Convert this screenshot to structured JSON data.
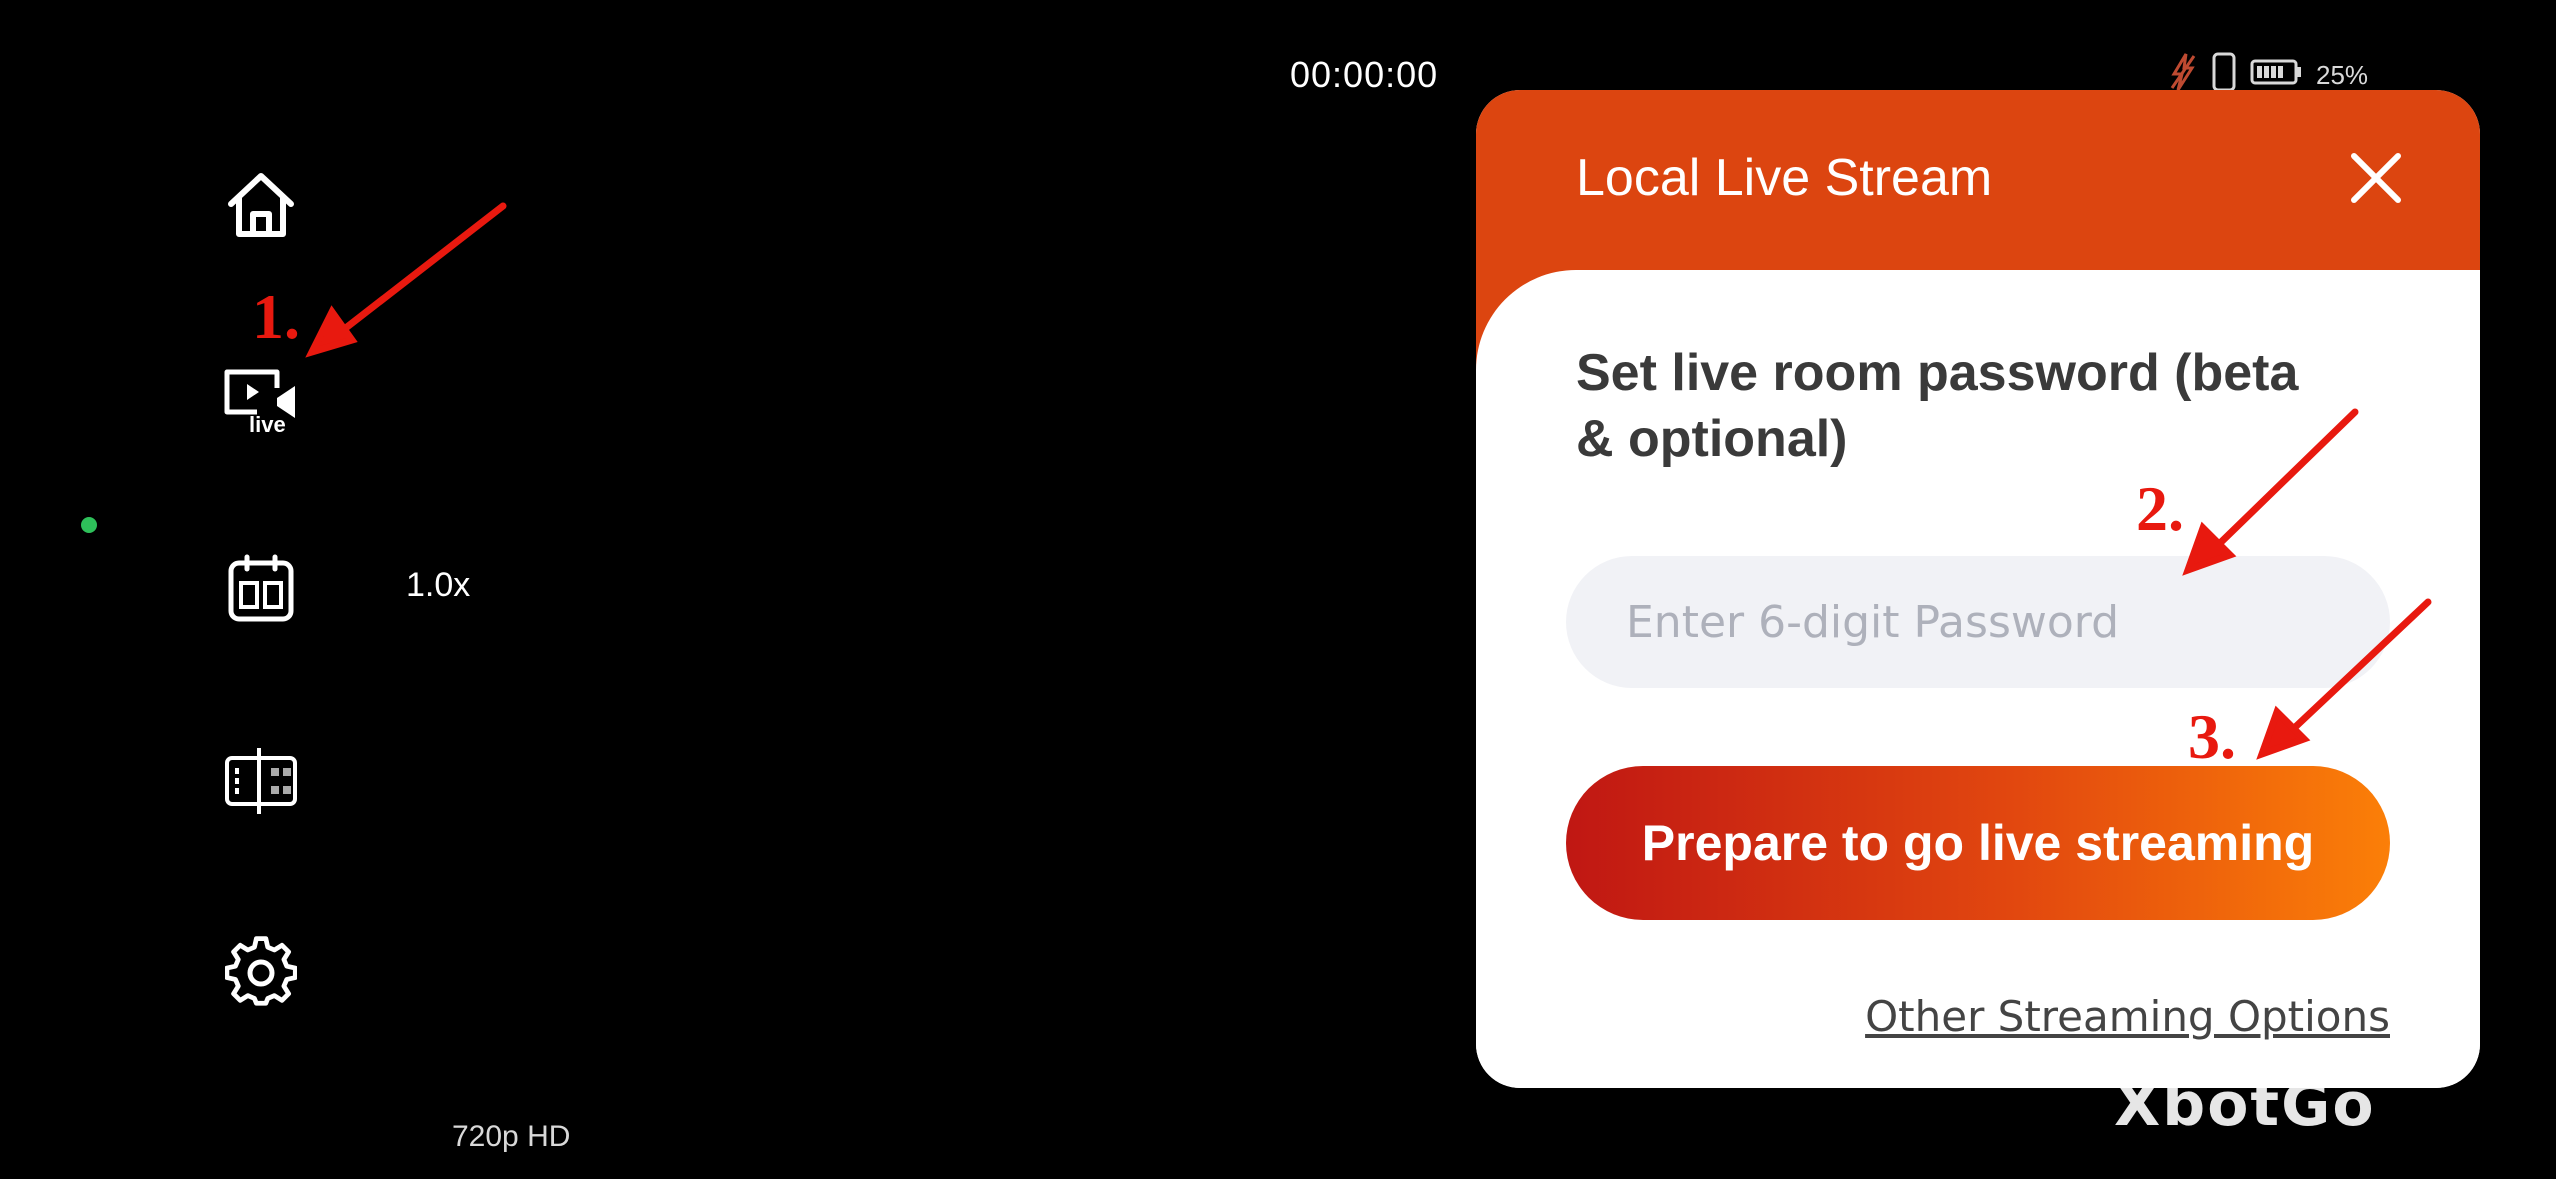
{
  "status": {
    "timer": "00:00:00",
    "battery": "25%"
  },
  "sidebar": {
    "items": [
      {
        "icon": "home-icon"
      },
      {
        "icon": "live-video-icon",
        "badge": "live"
      },
      {
        "icon": "calendar-split-icon"
      },
      {
        "icon": "film-frame-icon"
      },
      {
        "icon": "gear-icon"
      }
    ]
  },
  "camera": {
    "zoom": "1.0x",
    "resolution": "720p HD",
    "brand": "XbotGo"
  },
  "dialog": {
    "title": "Local Live Stream",
    "section_title": "Set live room password (beta & optional)",
    "password_placeholder": "Enter 6-digit Password",
    "password_value": "",
    "primary_button": "Prepare to go live streaming",
    "secondary_link": "Other Streaming Options"
  },
  "annotations": [
    "1.",
    "2.",
    "3."
  ],
  "colors": {
    "header": "#dc4510",
    "button_start": "#c01713",
    "button_end": "#fb7f08",
    "annotation": "#e8190f",
    "status_dot": "#2ec05a"
  }
}
